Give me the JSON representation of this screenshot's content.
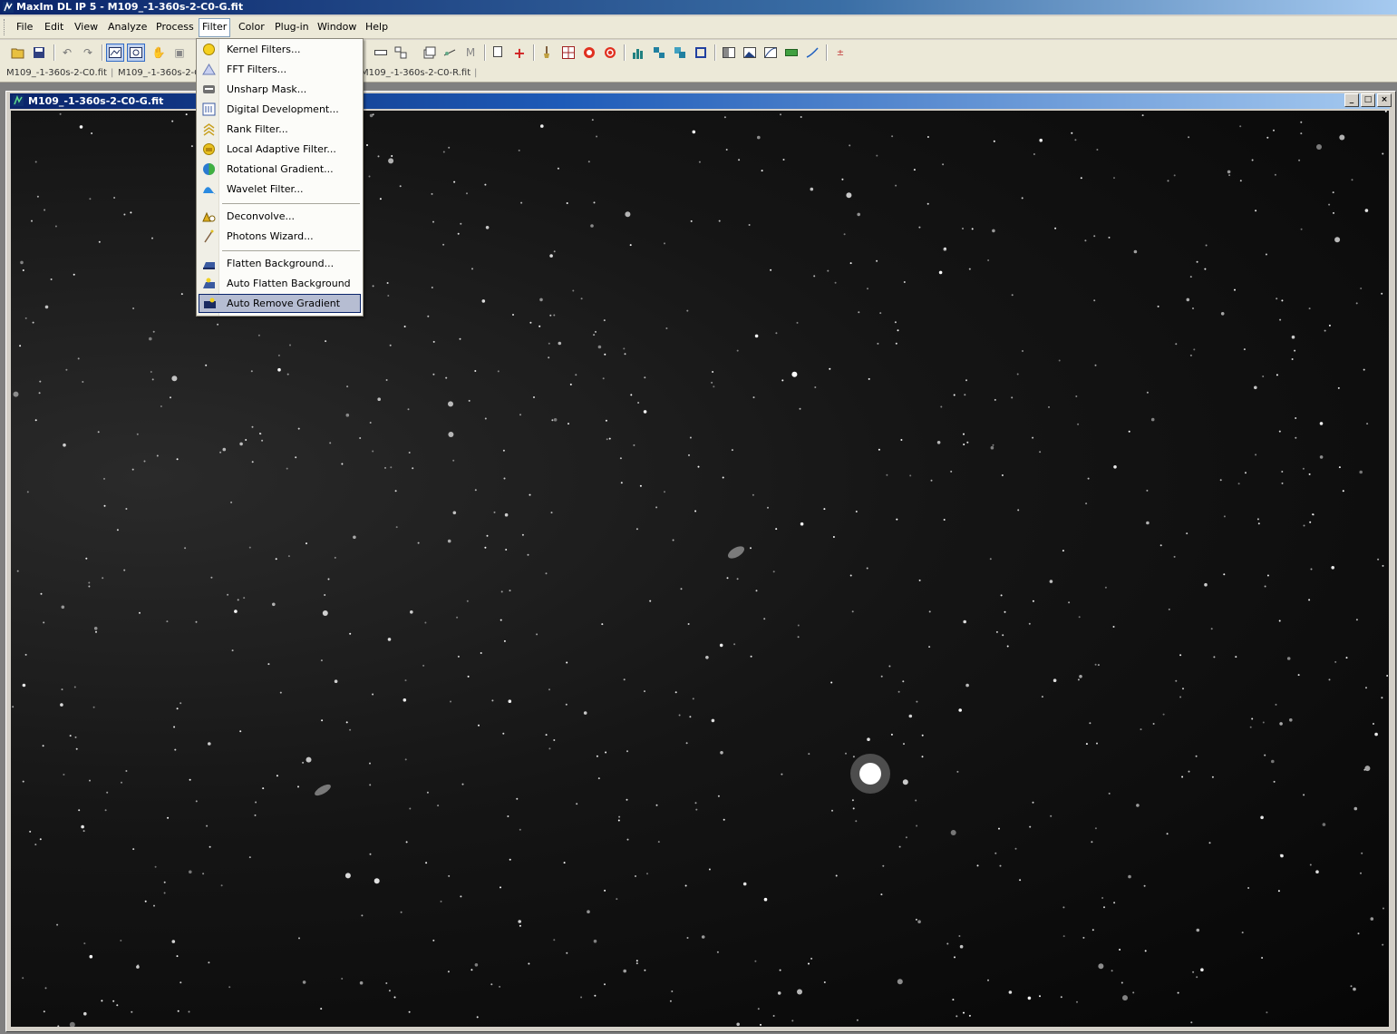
{
  "app": {
    "title": "MaxIm DL IP 5 - M109_-1-360s-2-C0-G.fit"
  },
  "menubar": {
    "items": [
      {
        "label": "File",
        "underline": "F"
      },
      {
        "label": "Edit",
        "underline": "E"
      },
      {
        "label": "View",
        "underline": "V"
      },
      {
        "label": "Analyze",
        "underline": "A"
      },
      {
        "label": "Process",
        "underline": "P"
      },
      {
        "label": "Filter",
        "underline": "i",
        "open": true
      },
      {
        "label": "Color",
        "underline": "C"
      },
      {
        "label": "Plug-in",
        "underline": "g"
      },
      {
        "label": "Window",
        "underline": "W"
      },
      {
        "label": "Help",
        "underline": "H"
      }
    ]
  },
  "toolbar": {
    "buttons": [
      "open-icon",
      "save-icon",
      "undo-icon",
      "redo-icon",
      "screen-stretch-icon",
      "zoom-fit-icon",
      "hand-icon",
      "lock-icon",
      "ruler-icon",
      "stack-icon",
      "layers-icon",
      "align-icon",
      "measure-icon",
      "copy-icon",
      "crosshair-icon",
      "brush-icon",
      "grid-icon",
      "target-icon",
      "red-circle-icon",
      "histogram-icon",
      "tile-icon",
      "cascade-icon",
      "frame-icon",
      "levels-icon",
      "image-icon",
      "curves-icon",
      "slider-icon",
      "line-icon",
      "plus-minus-icon"
    ]
  },
  "doctabs": {
    "tabs": [
      "M109_-1-360s-2-C0.fit",
      "M109_-1-360s-2-C",
      "M109_-1-360s-2-C0-R.fit"
    ]
  },
  "document": {
    "title": "M109_-1-360s-2-C0-G.fit",
    "controls": {
      "minimize": "_",
      "maximize": "□",
      "close": "×"
    }
  },
  "filter_menu": {
    "items": [
      {
        "label": "Kernel Filters...",
        "icon": "kernel-filter-icon",
        "accent": "#f5d020"
      },
      {
        "label": "FFT Filters...",
        "icon": "fft-filter-icon",
        "accent": "#6a7bb5"
      },
      {
        "label": "Unsharp Mask...",
        "icon": "unsharp-mask-icon",
        "accent": "#5a5a5a"
      },
      {
        "label": "Digital Development...",
        "icon": "digital-development-icon",
        "accent": "#3a5aa0"
      },
      {
        "label": "Rank Filter...",
        "icon": "rank-filter-icon",
        "accent": "#c8a020"
      },
      {
        "label": "Local Adaptive Filter...",
        "icon": "local-adaptive-filter-icon",
        "accent": "#e8c020"
      },
      {
        "label": "Rotational Gradient...",
        "icon": "rotational-gradient-icon",
        "accent": "#2a7ad0"
      },
      {
        "label": "Wavelet Filter...",
        "icon": "wavelet-filter-icon",
        "accent": "#2a8ae0"
      }
    ],
    "items2": [
      {
        "label": "Deconvolve...",
        "icon": "deconvolve-icon",
        "accent": "#e0b020"
      },
      {
        "label": "Photons Wizard...",
        "icon": "photons-wizard-icon",
        "accent": "#806040"
      }
    ],
    "items3": [
      {
        "label": "Flatten Background...",
        "icon": "flatten-background-icon",
        "accent": "#3a5aa0"
      },
      {
        "label": "Auto Flatten Background",
        "icon": "auto-flatten-background-icon",
        "accent": "#3a5aa0"
      },
      {
        "label": "Auto Remove Gradient",
        "icon": "auto-remove-gradient-icon",
        "accent": "#3a5aa0",
        "highlighted": true
      }
    ]
  }
}
